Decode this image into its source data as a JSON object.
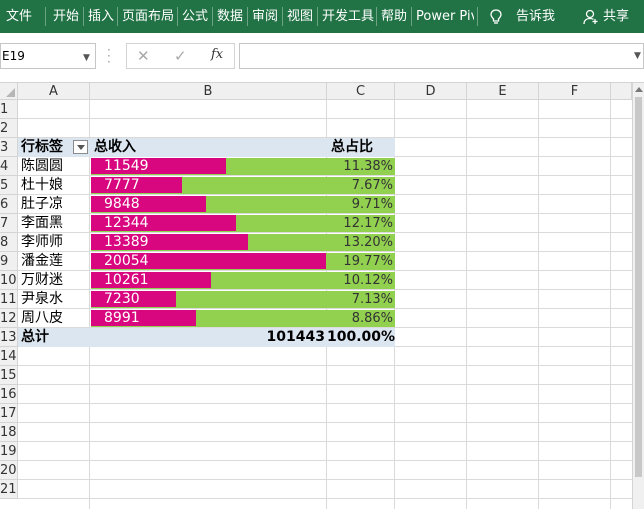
{
  "ribbon": {
    "tabs": [
      "文件",
      "开始",
      "插入",
      "页面布局",
      "公式",
      "数据",
      "审阅",
      "视图",
      "开发工具",
      "帮助",
      "Power Pivot"
    ],
    "tell_me": "告诉我",
    "share": "共享",
    "color": "#217346"
  },
  "formula_bar": {
    "name_box": "E19",
    "formula": "",
    "fx_label": "fx"
  },
  "grid": {
    "columns": [
      "A",
      "B",
      "C",
      "D",
      "E",
      "F"
    ],
    "rows": [
      "1",
      "2",
      "3",
      "4",
      "5",
      "6",
      "7",
      "8",
      "9",
      "10",
      "11",
      "12",
      "13",
      "14",
      "15",
      "16",
      "17",
      "18",
      "19",
      "20",
      "21"
    ]
  },
  "pivot": {
    "header": {
      "row_label": "行标签",
      "income": "总收入",
      "ratio": "总占比"
    },
    "rows": [
      {
        "name": "陈圆圆",
        "income": "11549",
        "ratio": "11.38%",
        "bar": 0.5759
      },
      {
        "name": "杜十娘",
        "income": "7777",
        "ratio": "7.67%",
        "bar": 0.3878
      },
      {
        "name": "肚子凉",
        "income": "9848",
        "ratio": "9.71%",
        "bar": 0.4911
      },
      {
        "name": "李面黑",
        "income": "12344",
        "ratio": "12.17%",
        "bar": 0.6155
      },
      {
        "name": "李师师",
        "income": "13389",
        "ratio": "13.20%",
        "bar": 0.6676
      },
      {
        "name": "潘金莲",
        "income": "20054",
        "ratio": "19.77%",
        "bar": 1.0
      },
      {
        "name": "万财迷",
        "income": "10261",
        "ratio": "10.12%",
        "bar": 0.5117
      },
      {
        "name": "尹泉水",
        "income": "7230",
        "ratio": "7.13%",
        "bar": 0.3605
      },
      {
        "name": "周八皮",
        "income": "8991",
        "ratio": "8.86%",
        "bar": 0.4483
      }
    ],
    "total": {
      "label": "总计",
      "income": "101443",
      "ratio": "100.00%"
    },
    "colors": {
      "bar": "#d9077f",
      "cell": "#92d050",
      "band": "#dce6f1"
    }
  }
}
